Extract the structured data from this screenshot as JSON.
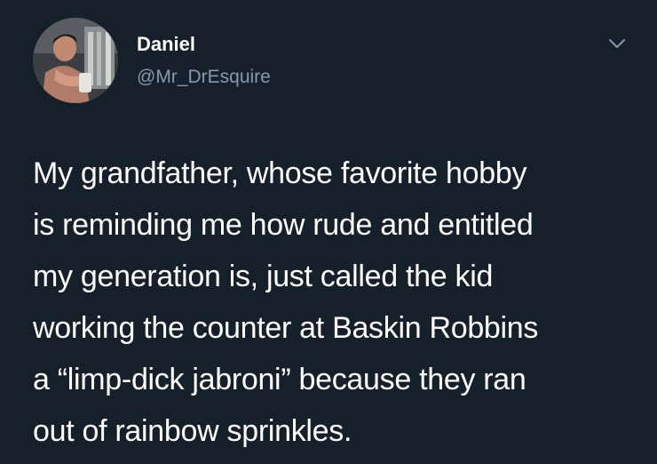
{
  "author": {
    "name": "Daniel",
    "handle": "@Mr_DrEsquire",
    "avatar_description": "profile-photo"
  },
  "menu": {
    "icon": "chevron-down-icon"
  },
  "tweet": {
    "lines": [
      "My grandfather, whose favorite hobby",
      "is reminding me how rude and entitled",
      "my generation is, just called the kid",
      "working the counter at Baskin Robbins",
      "a “limp-dick jabroni” because they ran",
      "out of rainbow sprinkles."
    ]
  },
  "colors": {
    "background": "#15202b",
    "text": "#ffffff",
    "secondary_text": "#8899a6"
  }
}
